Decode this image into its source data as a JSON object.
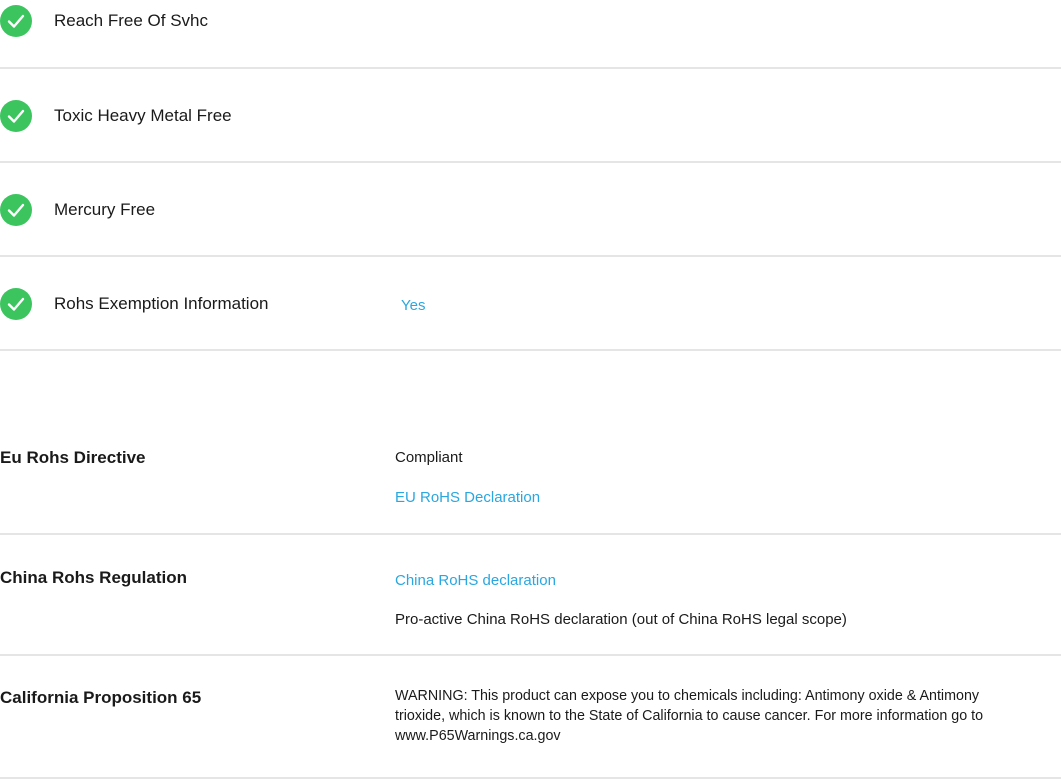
{
  "compliance_badges": [
    {
      "label": "Reach Free Of Svhc",
      "icon": "check-circle-icon",
      "value": ""
    },
    {
      "label": "Toxic Heavy Metal Free",
      "icon": "check-circle-icon",
      "value": ""
    },
    {
      "label": "Mercury Free",
      "icon": "check-circle-icon",
      "value": ""
    },
    {
      "label": "Rohs Exemption Information",
      "icon": "check-circle-icon",
      "value": "Yes"
    }
  ],
  "regulations": {
    "eu_rohs": {
      "title": "Eu Rohs Directive",
      "status": "Compliant",
      "link": "EU RoHS Declaration"
    },
    "china_rohs": {
      "title": "China Rohs Regulation",
      "link": "China RoHS declaration",
      "note": "Pro-active China RoHS declaration (out of China RoHS legal scope)"
    },
    "california_prop65": {
      "title": "California Proposition 65",
      "warning": "WARNING: This product can expose you to chemicals including: Antimony oxide & Antimony trioxide, which is known to the State of California to cause cancer. For more information go to www.P65Warnings.ca.gov"
    }
  },
  "colors": {
    "check_green": "#3cc55f",
    "link_blue": "#2aa7e0",
    "divider_gray": "#e5e5e5"
  }
}
